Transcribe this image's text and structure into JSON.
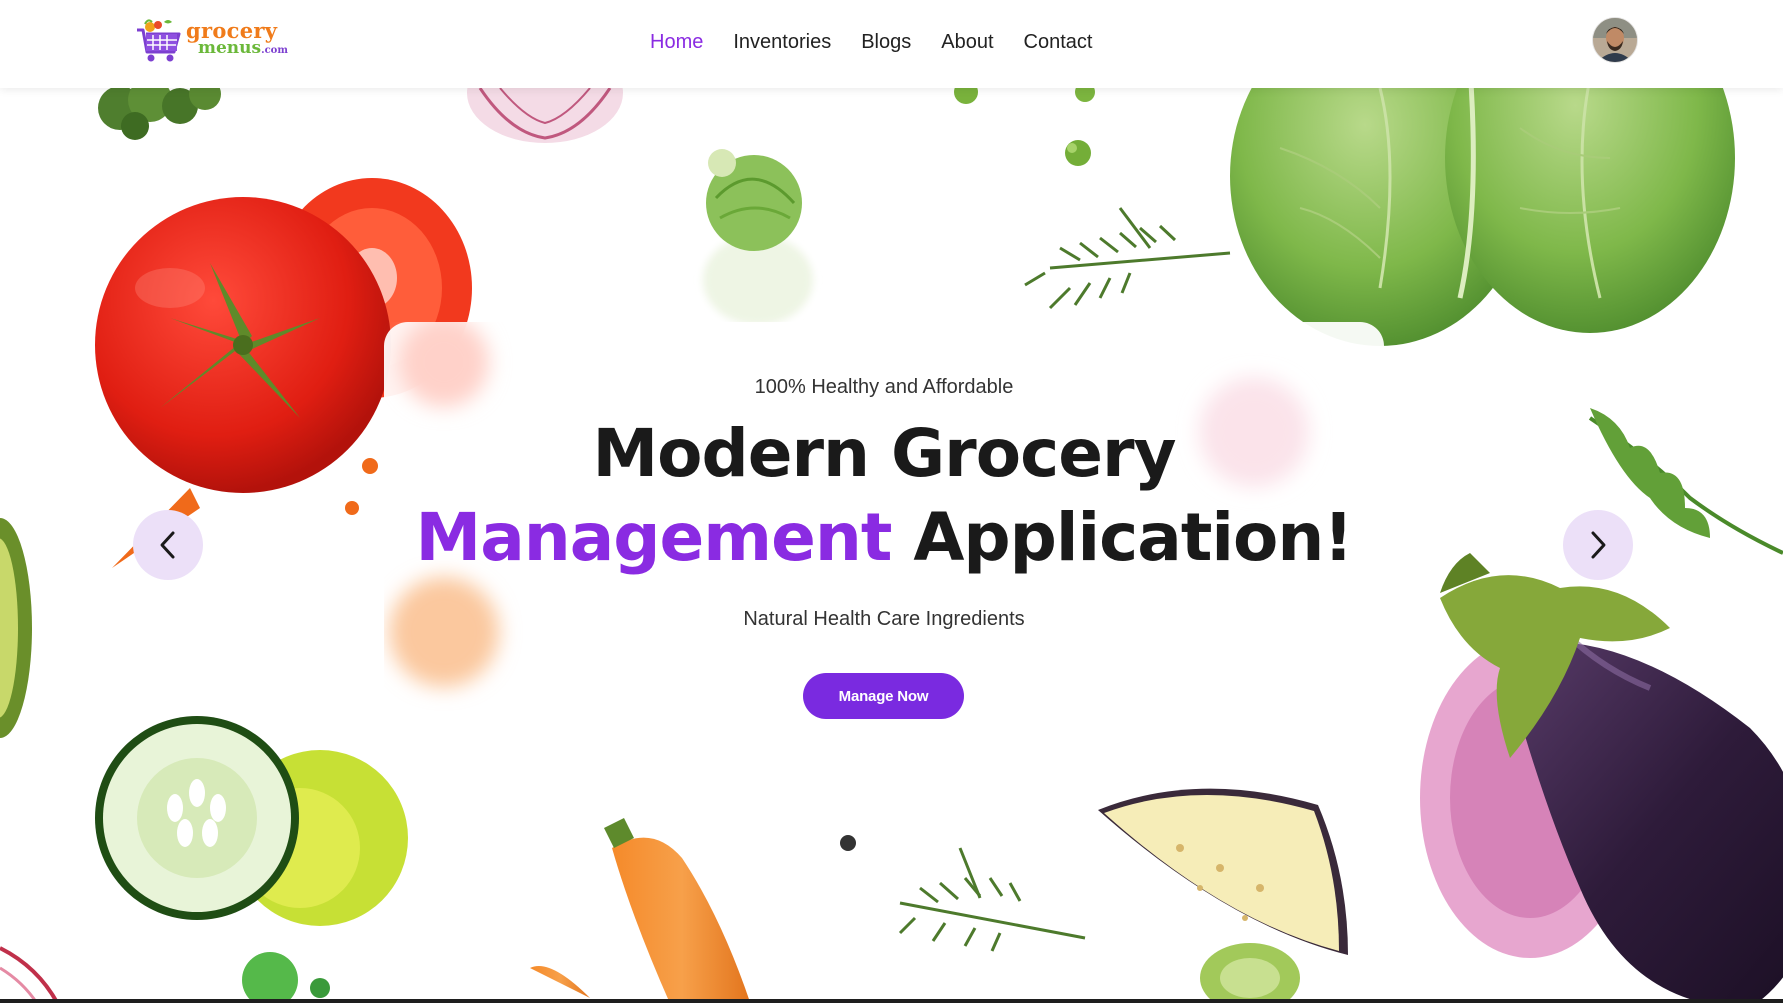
{
  "brand": {
    "logo_line1": "grocery",
    "logo_line2": "menus",
    "logo_suffix": ".com"
  },
  "nav": {
    "items": [
      {
        "label": "Home",
        "active": true
      },
      {
        "label": "Inventories",
        "active": false
      },
      {
        "label": "Blogs",
        "active": false
      },
      {
        "label": "About",
        "active": false
      },
      {
        "label": "Contact",
        "active": false
      }
    ],
    "active_color": "#8a2be2"
  },
  "hero": {
    "eyebrow": "100% Healthy and Affordable",
    "headline_line1": "Modern Grocery",
    "headline_accent": "Management",
    "headline_rest": " Application!",
    "subline": "Natural Health Care Ingredients",
    "cta_label": "Manage Now",
    "accent_color": "#8a2be2",
    "prev_icon": "chevron-left-icon",
    "next_icon": "chevron-right-icon"
  }
}
